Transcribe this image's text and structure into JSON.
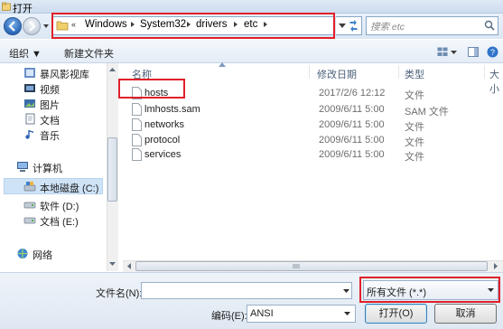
{
  "window": {
    "title": "打开"
  },
  "address": {
    "crumbs": [
      "Windows",
      "System32",
      "drivers",
      "etc"
    ],
    "overflow_glyph": "«"
  },
  "search": {
    "placeholder": "搜索 etc"
  },
  "toolbar": {
    "organize_label": "组织 ▼",
    "new_folder_label": "新建文件夹"
  },
  "sidebar": {
    "favorites": [
      {
        "label": "暴风影视库",
        "icon": "library-icon"
      },
      {
        "label": "视频",
        "icon": "video-icon"
      },
      {
        "label": "图片",
        "icon": "picture-icon"
      },
      {
        "label": "文档",
        "icon": "document-icon"
      },
      {
        "label": "音乐",
        "icon": "music-icon"
      }
    ],
    "computer": {
      "label": "计算机"
    },
    "drives": [
      {
        "label": "本地磁盘 (C:)",
        "selected": true
      },
      {
        "label": "软件 (D:)",
        "selected": false
      },
      {
        "label": "文档 (E:)",
        "selected": false
      }
    ],
    "network": {
      "label": "网络"
    }
  },
  "columns": {
    "name": "名称",
    "date": "修改日期",
    "type": "类型",
    "size": "大小"
  },
  "files": [
    {
      "name": "hosts",
      "date": "2017/2/6 12:12",
      "type": "文件"
    },
    {
      "name": "lmhosts.sam",
      "date": "2009/6/11 5:00",
      "type": "SAM 文件"
    },
    {
      "name": "networks",
      "date": "2009/6/11 5:00",
      "type": "文件"
    },
    {
      "name": "protocol",
      "date": "2009/6/11 5:00",
      "type": "文件"
    },
    {
      "name": "services",
      "date": "2009/6/11 5:00",
      "type": "文件"
    }
  ],
  "bottom": {
    "filename_label": "文件名(N):",
    "filename_value": "",
    "filetype_value": "所有文件 (*.*)",
    "encoding_label": "编码(E):",
    "encoding_value": "ANSI",
    "open_label": "打开(O)",
    "cancel_label": "取消"
  },
  "colors": {
    "highlight_red": "#e0202a",
    "selection_blue": "#cfe3f7"
  }
}
